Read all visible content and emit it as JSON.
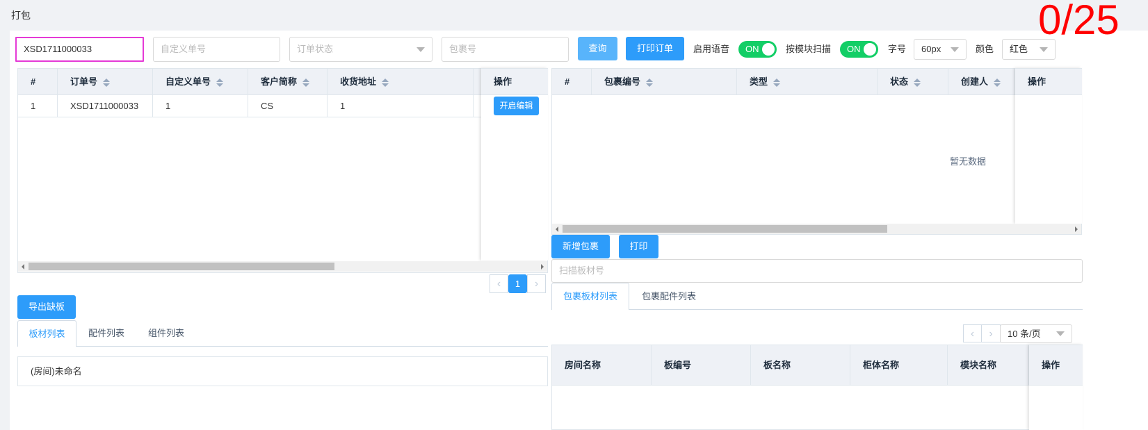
{
  "page": {
    "title": "打包"
  },
  "counter": "0/25",
  "toolbar": {
    "order_no_value": "XSD1711000033",
    "custom_no_placeholder": "自定义单号",
    "order_status_placeholder": "订单状态",
    "package_no_placeholder": "包裹号",
    "query_label": "查询",
    "print_order_label": "打印订单",
    "voice_label": "启用语音",
    "voice_toggle": "ON",
    "module_scan_label": "按模块扫描",
    "module_scan_toggle": "ON",
    "font_size_label": "字号",
    "font_size_value": "60px",
    "color_label": "颜色",
    "color_value": "红色"
  },
  "orders_table": {
    "headers": [
      "#",
      "订单号",
      "自定义单号",
      "客户简称",
      "收货地址",
      "操作"
    ],
    "rows": [
      {
        "index": "1",
        "order_no": "XSD1711000033",
        "custom_no": "1",
        "customer": "CS",
        "address": "1",
        "action": "开启编辑"
      }
    ],
    "pager_page": "1"
  },
  "packages_table": {
    "headers": [
      "#",
      "包裹编号",
      "类型",
      "状态",
      "创建人",
      "操作"
    ],
    "empty_text": "暂无数据"
  },
  "package_actions": {
    "add_label": "新增包裹",
    "print_label": "打印",
    "scan_placeholder": "扫描板材号"
  },
  "package_tabs": [
    "包裹板材列表",
    "包裹配件列表"
  ],
  "package_pager": {
    "page_size": "10 条/页"
  },
  "board_table": {
    "headers": [
      "房间名称",
      "板编号",
      "板名称",
      "柜体名称",
      "模块名称",
      "操作"
    ]
  },
  "left_bottom": {
    "export_label": "导出缺板",
    "tabs": [
      "板材列表",
      "配件列表",
      "组件列表"
    ],
    "room_item": "(房间)未命名"
  },
  "colors": {
    "accent": "#2d9cfa",
    "switch_on": "#13ce66",
    "counter": "#ff0000",
    "focus_border": "#e53ad6"
  }
}
